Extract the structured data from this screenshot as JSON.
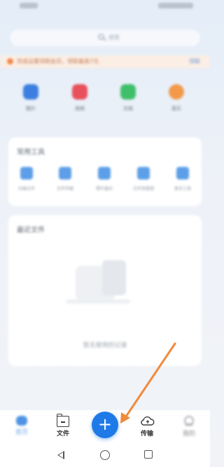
{
  "search": {
    "placeholder": "搜索"
  },
  "notice": {
    "text": "完成设置领取会员，领取最高7元",
    "action": "领取"
  },
  "quick_actions": [
    {
      "label": "图片",
      "icon": "image-icon",
      "color": "#3d7fe0"
    },
    {
      "label": "视频",
      "icon": "video-icon",
      "color": "#e8505b"
    },
    {
      "label": "文档",
      "icon": "document-icon",
      "color": "#3fbf6a"
    },
    {
      "label": "音乐",
      "icon": "music-icon",
      "color": "#f2994a"
    }
  ],
  "common_tools": {
    "title": "常用工具",
    "items": [
      {
        "label": "扫描文件",
        "icon": "scan-icon"
      },
      {
        "label": "文件传输",
        "icon": "transfer-icon"
      },
      {
        "label": "照片备份",
        "icon": "photo-backup-icon"
      },
      {
        "label": "文件夹管理",
        "icon": "folder-manage-icon"
      },
      {
        "label": "更多工具",
        "icon": "more-tools-icon"
      }
    ]
  },
  "recent": {
    "title": "最近文件",
    "empty_text": "暂无使用的记录"
  },
  "tabbar": {
    "home": "首页",
    "files": "文件",
    "add": "+",
    "transfer": "传输",
    "mine": "我的"
  },
  "colors": {
    "accent": "#1f7ae8",
    "annotation_arrow": "#f08a3c"
  }
}
